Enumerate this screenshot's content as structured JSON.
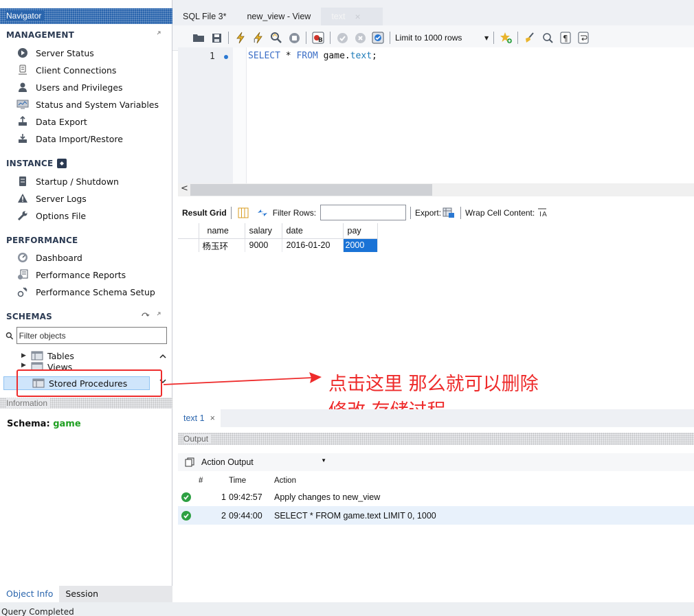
{
  "navigator": {
    "title": "Navigator",
    "sections": {
      "management": "MANAGEMENT",
      "instance": "INSTANCE",
      "performance": "PERFORMANCE",
      "schemas": "SCHEMAS"
    },
    "management_items": [
      "Server Status",
      "Client Connections",
      "Users and Privileges",
      "Status and System Variables",
      "Data Export",
      "Data Import/Restore"
    ],
    "instance_items": [
      "Startup / Shutdown",
      "Server Logs",
      "Options File"
    ],
    "performance_items": [
      "Dashboard",
      "Performance Reports",
      "Performance Schema Setup"
    ],
    "filter_placeholder": "Filter objects",
    "tree": [
      "Tables",
      "Views",
      "Stored Procedures"
    ]
  },
  "information": {
    "header": "Information",
    "schema_label": "Schema:",
    "schema_value": "game"
  },
  "bottom_tabs": [
    "Object Info",
    "Session"
  ],
  "status_bar": "Query Completed",
  "editor_tabs": [
    "SQL File 3*",
    "new_view - View",
    "text"
  ],
  "toolbar": {
    "limit_label": "Limit to 1000 rows"
  },
  "editor": {
    "line_number": "1",
    "sql": {
      "kw1": "SELECT",
      "star": " * ",
      "kw2": "FROM",
      "schema": " game.",
      "table": "text",
      "end": ";"
    }
  },
  "result_toolbar": {
    "result_grid": "Result Grid",
    "filter_rows": "Filter Rows:",
    "export": "Export:",
    "wrap": "Wrap Cell Content:"
  },
  "grid": {
    "columns": [
      "name",
      "salary",
      "date",
      "pay"
    ],
    "rows": [
      [
        "杨玉环",
        "9000",
        "2016-01-20",
        "2000"
      ]
    ]
  },
  "annotation": {
    "line1": "点击这里 那么就可以删除",
    "line2": "修改 存储过程",
    "color": "#ee2b2b"
  },
  "result_tab": "text 1",
  "output": {
    "header": "Output",
    "selector": "Action Output",
    "columns": [
      "#",
      "Time",
      "Action"
    ],
    "rows": [
      [
        "1",
        "09:42:57",
        "Apply changes to new_view"
      ],
      [
        "2",
        "09:44:00",
        "SELECT * FROM game.text LIMIT 0, 1000"
      ]
    ]
  },
  "colors": {
    "accent": "#2a65ad",
    "selection": "#1a73d6",
    "ok": "#2ea043",
    "annotation": "#ee2b2b"
  }
}
